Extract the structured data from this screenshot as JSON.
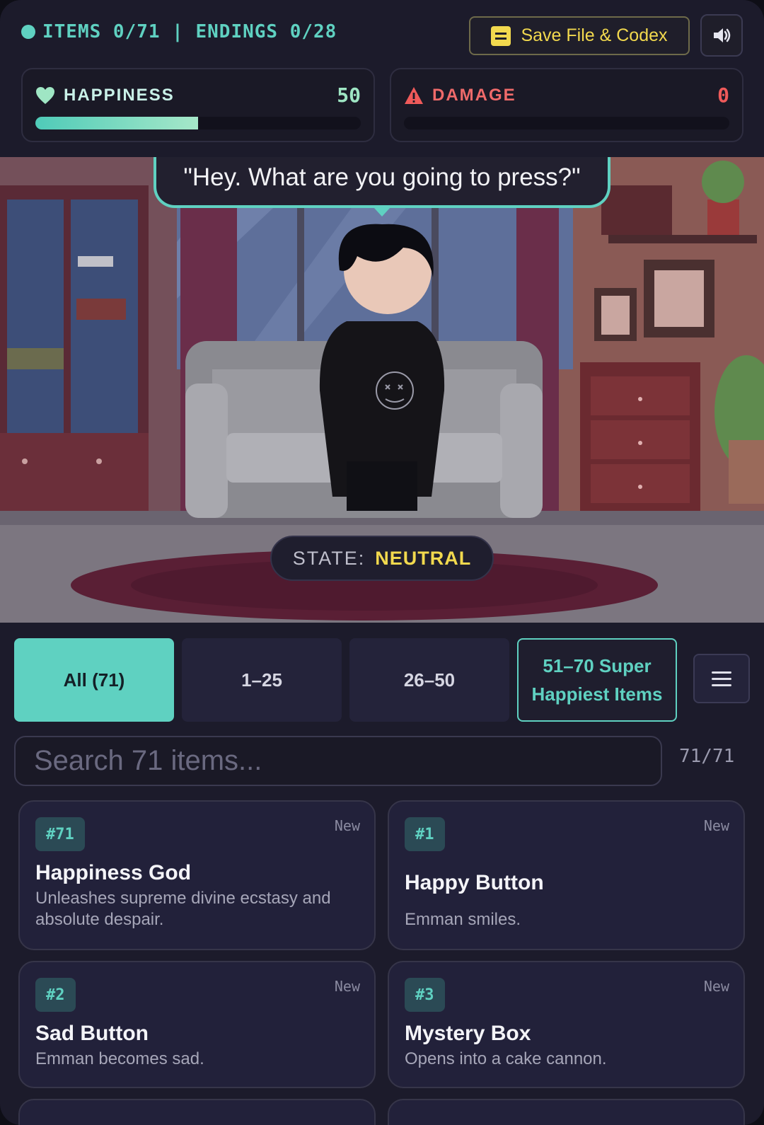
{
  "hud": {
    "counter": "ITEMS 0/71 | ENDINGS 0/28",
    "save_label": "Save File & Codex",
    "sound_icon": "speaker-icon"
  },
  "stats": {
    "happiness": {
      "label": "HAPPINESS",
      "value": "50",
      "fraction": 0.5,
      "color": "#5fd1c1"
    },
    "damage": {
      "label": "DAMAGE",
      "value": "0",
      "fraction": 0.0,
      "color": "#ef5a5a"
    }
  },
  "scene": {
    "dialogue": "\"Hey. What are you going to press?\"",
    "state_label": "STATE:",
    "state_value": "NEUTRAL"
  },
  "tabs": [
    {
      "label": "All (71)",
      "active": true
    },
    {
      "label": "1–25",
      "active": false
    },
    {
      "label": "26–50",
      "active": false
    },
    {
      "label": "51–70 Super Happiest Items",
      "active": false
    }
  ],
  "search": {
    "placeholder": "Search 71 items...",
    "value": "",
    "count": "71/71"
  },
  "items": [
    {
      "id": "#71",
      "title": "Happiness God",
      "desc": "Unleashes supreme divine ecstasy and absolute despair.",
      "tag": "New"
    },
    {
      "id": "#1",
      "title": "Happy Button",
      "desc": "Emman smiles.",
      "tag": "New"
    },
    {
      "id": "#2",
      "title": "Sad Button",
      "desc": "Emman becomes sad.",
      "tag": "New"
    },
    {
      "id": "#3",
      "title": "Mystery Box",
      "desc": "Opens into a cake cannon.",
      "tag": "New"
    }
  ]
}
